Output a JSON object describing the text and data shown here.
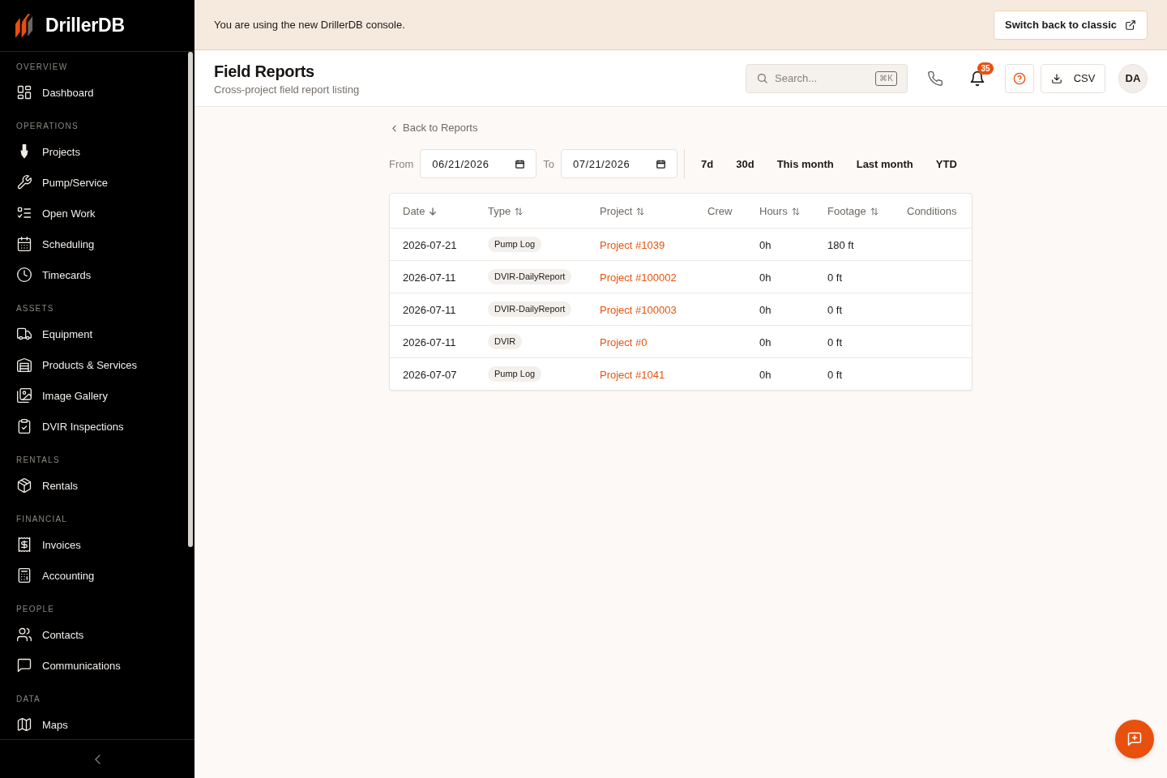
{
  "sidebar": {
    "brand": "DrillerDB",
    "sections": [
      {
        "label": "OVERVIEW",
        "items": [
          {
            "label": "Dashboard",
            "selected": false
          }
        ]
      },
      {
        "label": "OPERATIONS",
        "items": [
          {
            "label": "Projects",
            "selected": false
          },
          {
            "label": "Pump/Service",
            "selected": false
          },
          {
            "label": "Open Work",
            "selected": false
          },
          {
            "label": "Scheduling",
            "selected": false
          },
          {
            "label": "Timecards",
            "selected": false
          }
        ]
      },
      {
        "label": "ASSETS",
        "items": [
          {
            "label": "Equipment",
            "selected": false
          },
          {
            "label": "Products & Services",
            "selected": false
          },
          {
            "label": "Image Gallery",
            "selected": false
          },
          {
            "label": "DVIR Inspections",
            "selected": false
          }
        ]
      },
      {
        "label": "RENTALS",
        "items": [
          {
            "label": "Rentals",
            "selected": false
          }
        ]
      },
      {
        "label": "FINANCIAL",
        "items": [
          {
            "label": "Invoices",
            "selected": false
          },
          {
            "label": "Accounting",
            "selected": false
          }
        ]
      },
      {
        "label": "PEOPLE",
        "items": [
          {
            "label": "Contacts",
            "selected": false
          },
          {
            "label": "Communications",
            "selected": false
          }
        ]
      },
      {
        "label": "DATA",
        "items": [
          {
            "label": "Maps",
            "selected": false
          }
        ]
      }
    ]
  },
  "banner": {
    "message": "You are using the new DrillerDB console.",
    "button": "Switch back to classic"
  },
  "header": {
    "title": "Field Reports",
    "subtitle": "Cross-project field report listing",
    "search": {
      "placeholder": "Search...",
      "shortcut": "⌘K"
    },
    "notification_count": "35",
    "export_button": "CSV",
    "avatar": "DA"
  },
  "back_link": "Back to Reports",
  "filters": {
    "from_label": "From",
    "from_value": "06/21/2026",
    "to_label": "To",
    "to_value": "07/21/2026",
    "presets": [
      {
        "label": "7d",
        "selected": false
      },
      {
        "label": "30d",
        "selected": false
      },
      {
        "label": "This month",
        "selected": false
      },
      {
        "label": "Last month",
        "selected": false
      },
      {
        "label": "YTD",
        "selected": false
      }
    ]
  },
  "table": {
    "columns": [
      {
        "label": "Date",
        "sortable": true,
        "sorted": true
      },
      {
        "label": "Type",
        "sortable": true,
        "sorted": false
      },
      {
        "label": "Project",
        "sortable": true,
        "sorted": false
      },
      {
        "label": "Crew",
        "sortable": false,
        "sorted": false
      },
      {
        "label": "Hours",
        "sortable": true,
        "sorted": false
      },
      {
        "label": "Footage",
        "sortable": true,
        "sorted": false
      },
      {
        "label": "Conditions",
        "sortable": false,
        "sorted": false
      }
    ],
    "rows": [
      {
        "date": "2026-07-21",
        "type": "Pump Log",
        "project": "Project #1039",
        "hours": "0h",
        "footage": "180 ft"
      },
      {
        "date": "2026-07-11",
        "type": "DVIR-DailyReport",
        "project": "Project #100002",
        "hours": "0h",
        "footage": "0 ft"
      },
      {
        "date": "2026-07-11",
        "type": "DVIR-DailyReport",
        "project": "Project #100003",
        "hours": "0h",
        "footage": "0 ft"
      },
      {
        "date": "2026-07-11",
        "type": "DVIR",
        "project": "Project #0",
        "hours": "0h",
        "footage": "0 ft"
      },
      {
        "date": "2026-07-07",
        "type": "Pump Log",
        "project": "Project #1041",
        "hours": "0h",
        "footage": "0 ft"
      }
    ]
  }
}
